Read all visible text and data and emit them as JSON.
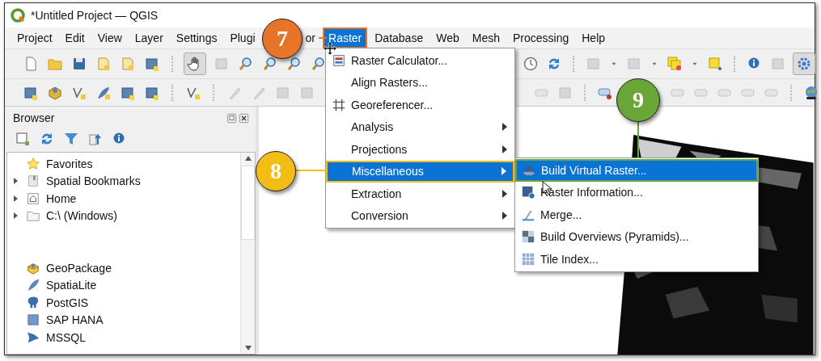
{
  "window": {
    "title": "*Untitled Project — QGIS"
  },
  "menubar": [
    {
      "label": "Project",
      "selected": false
    },
    {
      "label": "Edit",
      "selected": false
    },
    {
      "label": "View",
      "selected": false
    },
    {
      "label": "Layer",
      "selected": false
    },
    {
      "label": "Settings",
      "selected": false
    },
    {
      "label": "Plugi",
      "selected": false
    },
    {
      "label": "or",
      "selected": false
    },
    {
      "label": "Raster",
      "selected": true
    },
    {
      "label": "Database",
      "selected": false
    },
    {
      "label": "Web",
      "selected": false
    },
    {
      "label": "Mesh",
      "selected": false
    },
    {
      "label": "Processing",
      "selected": false
    },
    {
      "label": "Help",
      "selected": false
    }
  ],
  "raster_menu": [
    {
      "label": "Raster Calculator...",
      "kind": "action",
      "selected": false
    },
    {
      "label": "Align Rasters...",
      "kind": "action",
      "selected": false
    },
    {
      "label": "Georeferencer...",
      "kind": "action",
      "selected": false
    },
    {
      "label": "Analysis",
      "kind": "submenu",
      "selected": false
    },
    {
      "label": "Projections",
      "kind": "submenu",
      "selected": false
    },
    {
      "label": "Miscellaneous",
      "kind": "submenu",
      "selected": true
    },
    {
      "label": "Extraction",
      "kind": "submenu",
      "selected": false
    },
    {
      "label": "Conversion",
      "kind": "submenu",
      "selected": false
    }
  ],
  "misc_submenu": [
    {
      "label": "Build Virtual Raster...",
      "selected": true
    },
    {
      "label": "Raster Information...",
      "selected": false
    },
    {
      "label": "Merge...",
      "selected": false
    },
    {
      "label": "Build Overviews (Pyramids)...",
      "selected": false
    },
    {
      "label": "Tile Index...",
      "selected": false
    }
  ],
  "browser": {
    "title": "Browser",
    "locations": [
      {
        "label": "Favorites"
      },
      {
        "label": "Spatial Bookmarks",
        "expanded": false
      },
      {
        "label": "Home",
        "expanded": false
      },
      {
        "label": "C:\\ (Windows)",
        "expanded": false
      }
    ],
    "providers": [
      {
        "label": "GeoPackage"
      },
      {
        "label": "SpatiaLite"
      },
      {
        "label": "PostGIS"
      },
      {
        "label": "SAP HANA"
      },
      {
        "label": "MSSQL"
      }
    ]
  },
  "callouts": [
    {
      "number": "7",
      "color": "#e8742a"
    },
    {
      "number": "8",
      "color": "#f3bd16"
    },
    {
      "number": "9",
      "color": "#6aa538"
    }
  ]
}
